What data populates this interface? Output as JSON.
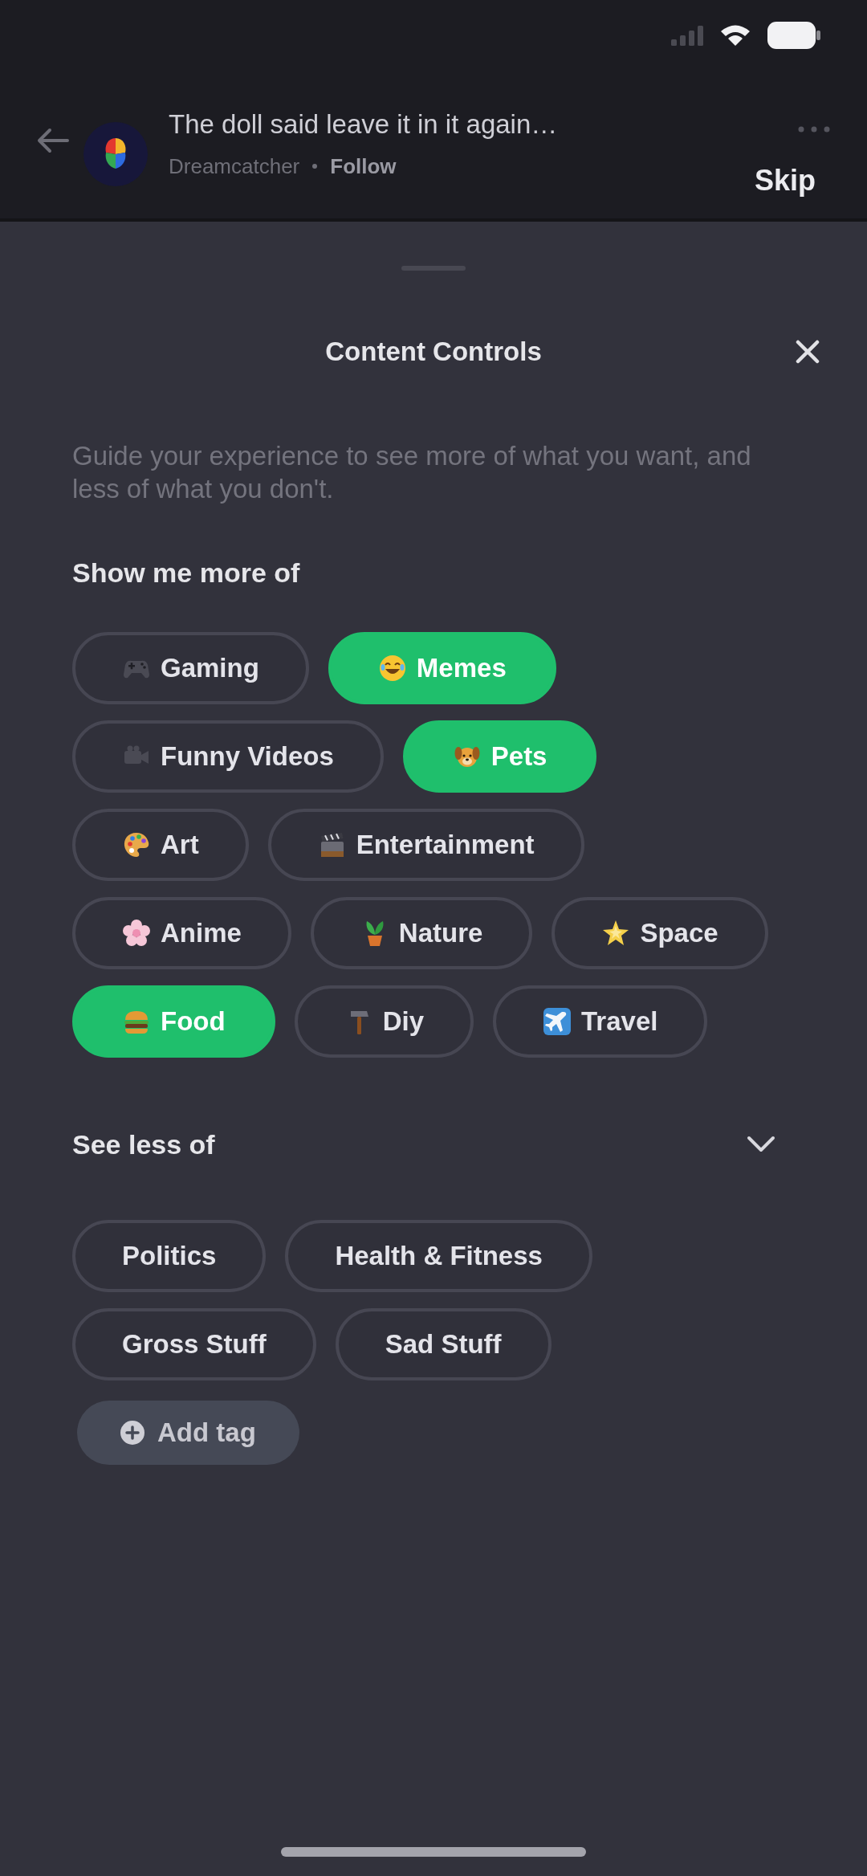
{
  "header": {
    "title": "The doll said leave it in it again…",
    "community": "Dreamcatcher",
    "follow_label": "Follow",
    "skip_label": "Skip"
  },
  "sheet": {
    "title": "Content Controls",
    "description": "Guide your experience to see more of what you want, and less of what you don't.",
    "more_section": {
      "heading": "Show me more of",
      "tags": [
        {
          "label": "Gaming",
          "selected": false
        },
        {
          "label": "Memes",
          "selected": true
        },
        {
          "label": "Funny Videos",
          "selected": false
        },
        {
          "label": "Pets",
          "selected": true
        },
        {
          "label": "Art",
          "selected": false
        },
        {
          "label": "Entertainment",
          "selected": false
        },
        {
          "label": "Anime",
          "selected": false
        },
        {
          "label": "Nature",
          "selected": false
        },
        {
          "label": "Space",
          "selected": false
        },
        {
          "label": "Food",
          "selected": true
        },
        {
          "label": "Diy",
          "selected": false
        },
        {
          "label": "Travel",
          "selected": false
        }
      ]
    },
    "less_section": {
      "heading": "See less of",
      "expanded": true,
      "tags": [
        {
          "label": "Politics",
          "selected": false
        },
        {
          "label": "Health & Fitness",
          "selected": false
        },
        {
          "label": "Gross Stuff",
          "selected": false
        },
        {
          "label": "Sad Stuff",
          "selected": false
        }
      ],
      "add_tag_label": "Add tag"
    }
  }
}
